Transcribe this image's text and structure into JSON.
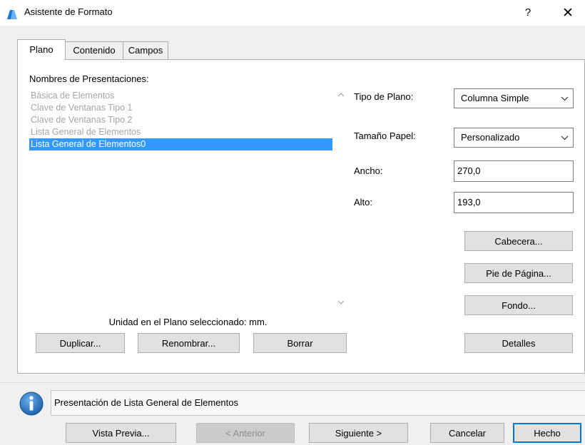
{
  "window": {
    "title": "Asistente de Formato",
    "help_label": "?",
    "close_label": "✕"
  },
  "tabs": [
    {
      "label": "Plano",
      "active": true
    },
    {
      "label": "Contenido",
      "active": false
    },
    {
      "label": "Campos",
      "active": false
    }
  ],
  "layouts": {
    "label": "Nombres de Presentaciones:",
    "items": [
      "Básica de Elementos",
      "Clave de Ventanas Tipo 1",
      "Clave de Ventanas Tipo 2",
      "Lista General de Elementos",
      "Lista General de Elementos0"
    ],
    "selected_index": 4,
    "unit_text": "Unidad en el Plano seleccionado: mm."
  },
  "left_buttons": {
    "duplicate": "Duplicar...",
    "rename": "Renombrar...",
    "delete": "Borrar"
  },
  "settings": {
    "tipo_label": "Tipo de Plano:",
    "tipo_value": "Columna Simple",
    "tamano_label": "Tamaño Papel:",
    "tamano_value": "Personalizado",
    "ancho_label": "Ancho:",
    "ancho_value": "270,0",
    "alto_label": "Alto:",
    "alto_value": "193,0"
  },
  "right_buttons": {
    "header": "Cabecera...",
    "footer": "Pie de Página...",
    "background": "Fondo...",
    "details": "Detalles"
  },
  "status": {
    "text": "Presentación de Lista General de Elementos"
  },
  "footer_buttons": {
    "preview": "Vista Previa...",
    "previous": "< Anterior",
    "next": "Siguiente >",
    "cancel": "Cancelar",
    "done": "Hecho"
  },
  "colors": {
    "selection": "#3399ff",
    "default_button_border": "#0078d7",
    "info_icon": "#1d64b0"
  },
  "icons": {
    "app": "archicad-app-icon",
    "info": "info-icon",
    "dropdown": "chevron-down-icon"
  }
}
